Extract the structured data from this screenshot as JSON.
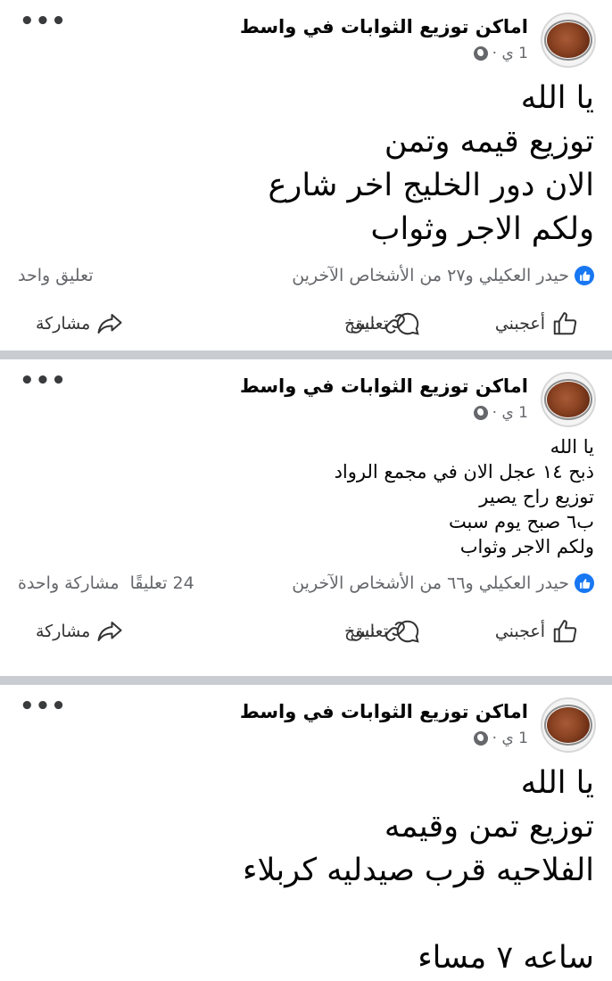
{
  "posts": [
    {
      "page_name": "اماكن توزيع الثوابات في واسط",
      "time": "1 ي ·",
      "text_lines": [
        "يا الله",
        "توزيع قيمه وتمن",
        "الان دور الخليج اخر شارع",
        "ولكم الاجر وثواب"
      ],
      "reactions": "حيدر العكيلي و٢٧ من الأشخاص الآخرين",
      "counts": "تعليق واحد",
      "actions": {
        "like": "أعجبني",
        "comment": "تعليق",
        "copy": "نسخ",
        "share": "مشاركة"
      }
    },
    {
      "page_name": "اماكن توزيع الثوابات في واسط",
      "time": "1 ي ·",
      "text_lines": [
        "يا الله",
        "ذبح ١٤ عجل الان في مجمع الرواد",
        "توزيع راح يصير",
        "ب٦ صبح يوم سبت",
        "ولكم الاجر وثواب"
      ],
      "reactions": "حيدر العكيلي و٦٦ من الأشخاص الآخرين",
      "counts": "24 تعليقًا  مشاركة واحدة",
      "actions": {
        "like": "أعجبني",
        "comment": "تعليق",
        "copy": "نسخ",
        "share": "مشاركة"
      }
    },
    {
      "page_name": "اماكن توزيع الثوابات في واسط",
      "time": "1 ي ·",
      "text_lines": [
        "يا الله",
        "توزيع تمن وقيمه",
        "الفلاحيه قرب صيدليه كربلاء",
        "",
        "ساعه ٧ مساء"
      ]
    }
  ],
  "icons": {
    "globe": "globe-icon",
    "more": "more-options-icon",
    "like": "thumbs-up-icon",
    "comment": "comment-bubble-icon",
    "copy": "link-copy-icon",
    "share": "share-arrow-icon"
  },
  "colors": {
    "like_blue": "#1877f2",
    "separator": "#c9ccd1",
    "secondary_text": "#65676b"
  }
}
